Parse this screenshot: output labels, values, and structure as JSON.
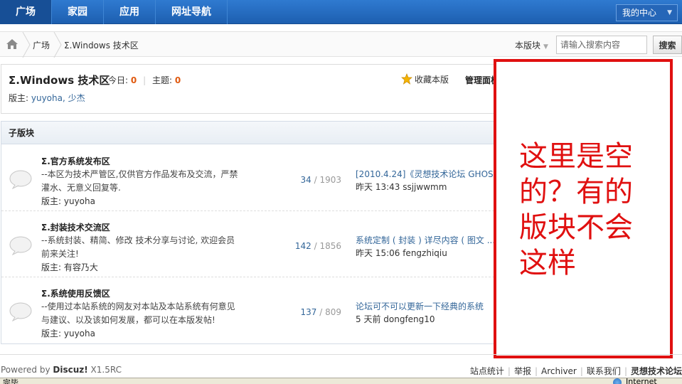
{
  "nav": {
    "items": [
      {
        "label": "广场",
        "active": true
      },
      {
        "label": "家园",
        "active": false
      },
      {
        "label": "应用",
        "active": false
      },
      {
        "label": "网址导航",
        "active": false
      }
    ],
    "my_center": "我的中心"
  },
  "breadcrumb": {
    "home_icon": "home-icon",
    "items": [
      "广场",
      "Σ.Windows 技术区"
    ]
  },
  "search": {
    "scope_label": "本版块",
    "placeholder": "请输入搜索内容",
    "button": "搜索"
  },
  "forum": {
    "title": "Σ.Windows 技术区",
    "today_label": "今日:",
    "today_value": "0",
    "topics_label": "主题:",
    "topics_value": "0",
    "favorite_label": "收藏本版",
    "manage_label": "管理面板",
    "moderators_label": "版主:",
    "moderators": "yuyoha, 少杰"
  },
  "subforums": {
    "header": "子版块",
    "rows": [
      {
        "title": "Σ.官方系统发布区",
        "description": "--本区为技术严管区,仅供官方作品发布及交流，严禁灌水、无意义回复等.",
        "moderator": "版主: yuyoha",
        "threads": "34",
        "posts": "1903",
        "last_post": "[2010.4.24]《灵想技术论坛 GHOS ...",
        "last_time": "昨天 13:43 ssjjwwmm"
      },
      {
        "title": "Σ.封装技术交流区",
        "description": "--系统封装、精简、修改 技术分享与讨论, 欢迎会员前来关注!",
        "moderator": "版主: 有容乃大",
        "threads": "142",
        "posts": "1856",
        "last_post": "系统定制 ( 封装 ) 详尽内容 ( 图文 ...",
        "last_time": "昨天 15:06 fengzhiqiu"
      },
      {
        "title": "Σ.系统使用反馈区",
        "description": "--使用过本站系统的网友对本站及本站系统有何意见与建议、以及该如何发展，都可以在本版发帖!",
        "moderator": "版主: yuyoha",
        "threads": "137",
        "posts": "809",
        "last_post": "论坛可不可以更新一下经典的系统",
        "last_time": "5 天前 dongfeng10"
      }
    ]
  },
  "annotation": {
    "text": "这里是空的？有的版块不会这样",
    "color": "#e01010"
  },
  "footer": {
    "powered_prefix": "Powered by ",
    "powered_brand": "Discuz!",
    "powered_version": " X1.5RC",
    "links": [
      "站点统计",
      "举报",
      "Archiver",
      "联系我们",
      "灵想技术论坛"
    ]
  },
  "statusbar": {
    "left": "完毕",
    "right": "Internet"
  }
}
